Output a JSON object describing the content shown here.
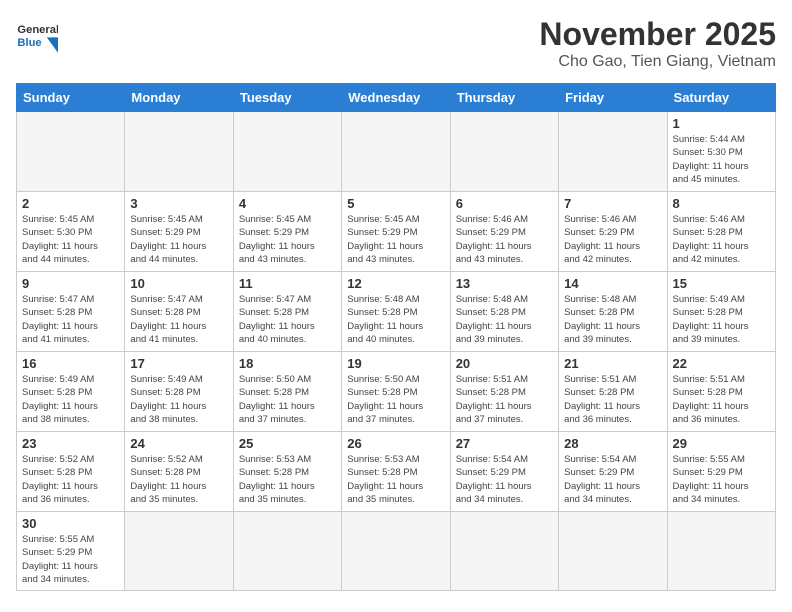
{
  "header": {
    "logo_general": "General",
    "logo_blue": "Blue",
    "month": "November 2025",
    "location": "Cho Gao, Tien Giang, Vietnam"
  },
  "weekdays": [
    "Sunday",
    "Monday",
    "Tuesday",
    "Wednesday",
    "Thursday",
    "Friday",
    "Saturday"
  ],
  "weeks": [
    [
      {
        "day": "",
        "info": ""
      },
      {
        "day": "",
        "info": ""
      },
      {
        "day": "",
        "info": ""
      },
      {
        "day": "",
        "info": ""
      },
      {
        "day": "",
        "info": ""
      },
      {
        "day": "",
        "info": ""
      },
      {
        "day": "1",
        "info": "Sunrise: 5:44 AM\nSunset: 5:30 PM\nDaylight: 11 hours\nand 45 minutes."
      }
    ],
    [
      {
        "day": "2",
        "info": "Sunrise: 5:45 AM\nSunset: 5:30 PM\nDaylight: 11 hours\nand 44 minutes."
      },
      {
        "day": "3",
        "info": "Sunrise: 5:45 AM\nSunset: 5:29 PM\nDaylight: 11 hours\nand 44 minutes."
      },
      {
        "day": "4",
        "info": "Sunrise: 5:45 AM\nSunset: 5:29 PM\nDaylight: 11 hours\nand 43 minutes."
      },
      {
        "day": "5",
        "info": "Sunrise: 5:45 AM\nSunset: 5:29 PM\nDaylight: 11 hours\nand 43 minutes."
      },
      {
        "day": "6",
        "info": "Sunrise: 5:46 AM\nSunset: 5:29 PM\nDaylight: 11 hours\nand 43 minutes."
      },
      {
        "day": "7",
        "info": "Sunrise: 5:46 AM\nSunset: 5:29 PM\nDaylight: 11 hours\nand 42 minutes."
      },
      {
        "day": "8",
        "info": "Sunrise: 5:46 AM\nSunset: 5:28 PM\nDaylight: 11 hours\nand 42 minutes."
      }
    ],
    [
      {
        "day": "9",
        "info": "Sunrise: 5:47 AM\nSunset: 5:28 PM\nDaylight: 11 hours\nand 41 minutes."
      },
      {
        "day": "10",
        "info": "Sunrise: 5:47 AM\nSunset: 5:28 PM\nDaylight: 11 hours\nand 41 minutes."
      },
      {
        "day": "11",
        "info": "Sunrise: 5:47 AM\nSunset: 5:28 PM\nDaylight: 11 hours\nand 40 minutes."
      },
      {
        "day": "12",
        "info": "Sunrise: 5:48 AM\nSunset: 5:28 PM\nDaylight: 11 hours\nand 40 minutes."
      },
      {
        "day": "13",
        "info": "Sunrise: 5:48 AM\nSunset: 5:28 PM\nDaylight: 11 hours\nand 39 minutes."
      },
      {
        "day": "14",
        "info": "Sunrise: 5:48 AM\nSunset: 5:28 PM\nDaylight: 11 hours\nand 39 minutes."
      },
      {
        "day": "15",
        "info": "Sunrise: 5:49 AM\nSunset: 5:28 PM\nDaylight: 11 hours\nand 39 minutes."
      }
    ],
    [
      {
        "day": "16",
        "info": "Sunrise: 5:49 AM\nSunset: 5:28 PM\nDaylight: 11 hours\nand 38 minutes."
      },
      {
        "day": "17",
        "info": "Sunrise: 5:49 AM\nSunset: 5:28 PM\nDaylight: 11 hours\nand 38 minutes."
      },
      {
        "day": "18",
        "info": "Sunrise: 5:50 AM\nSunset: 5:28 PM\nDaylight: 11 hours\nand 37 minutes."
      },
      {
        "day": "19",
        "info": "Sunrise: 5:50 AM\nSunset: 5:28 PM\nDaylight: 11 hours\nand 37 minutes."
      },
      {
        "day": "20",
        "info": "Sunrise: 5:51 AM\nSunset: 5:28 PM\nDaylight: 11 hours\nand 37 minutes."
      },
      {
        "day": "21",
        "info": "Sunrise: 5:51 AM\nSunset: 5:28 PM\nDaylight: 11 hours\nand 36 minutes."
      },
      {
        "day": "22",
        "info": "Sunrise: 5:51 AM\nSunset: 5:28 PM\nDaylight: 11 hours\nand 36 minutes."
      }
    ],
    [
      {
        "day": "23",
        "info": "Sunrise: 5:52 AM\nSunset: 5:28 PM\nDaylight: 11 hours\nand 36 minutes."
      },
      {
        "day": "24",
        "info": "Sunrise: 5:52 AM\nSunset: 5:28 PM\nDaylight: 11 hours\nand 35 minutes."
      },
      {
        "day": "25",
        "info": "Sunrise: 5:53 AM\nSunset: 5:28 PM\nDaylight: 11 hours\nand 35 minutes."
      },
      {
        "day": "26",
        "info": "Sunrise: 5:53 AM\nSunset: 5:28 PM\nDaylight: 11 hours\nand 35 minutes."
      },
      {
        "day": "27",
        "info": "Sunrise: 5:54 AM\nSunset: 5:29 PM\nDaylight: 11 hours\nand 34 minutes."
      },
      {
        "day": "28",
        "info": "Sunrise: 5:54 AM\nSunset: 5:29 PM\nDaylight: 11 hours\nand 34 minutes."
      },
      {
        "day": "29",
        "info": "Sunrise: 5:55 AM\nSunset: 5:29 PM\nDaylight: 11 hours\nand 34 minutes."
      }
    ],
    [
      {
        "day": "30",
        "info": "Sunrise: 5:55 AM\nSunset: 5:29 PM\nDaylight: 11 hours\nand 34 minutes."
      },
      {
        "day": "",
        "info": ""
      },
      {
        "day": "",
        "info": ""
      },
      {
        "day": "",
        "info": ""
      },
      {
        "day": "",
        "info": ""
      },
      {
        "day": "",
        "info": ""
      },
      {
        "day": "",
        "info": ""
      }
    ]
  ]
}
